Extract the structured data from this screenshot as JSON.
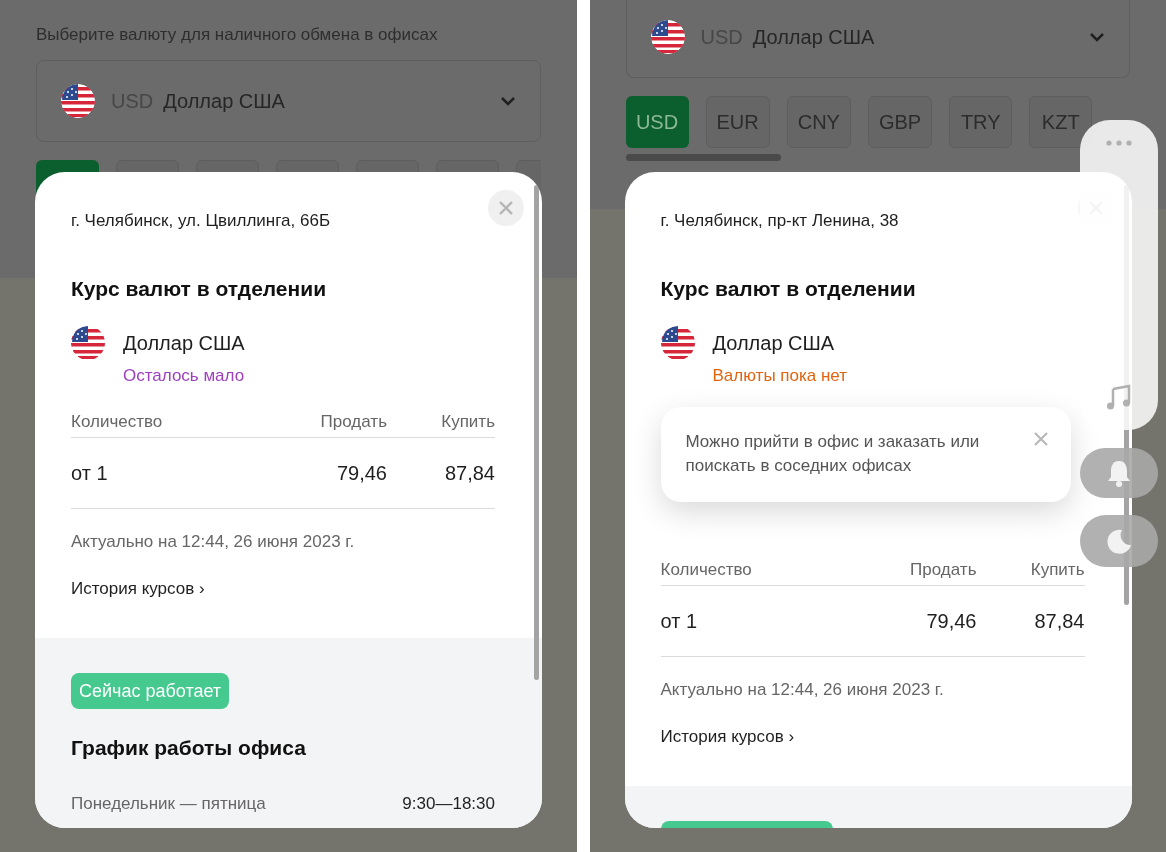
{
  "panels": [
    {
      "prompt": "Выберите валюту для наличного обмена в офисах",
      "currency_select": {
        "code": "USD",
        "name": "Доллар США"
      },
      "chips": [
        {
          "selected": true
        },
        {
          "selected": false
        },
        {
          "selected": false
        },
        {
          "selected": false
        },
        {
          "selected": false
        },
        {
          "selected": false
        },
        {
          "selected": false
        }
      ],
      "modal": {
        "address": "г. Челябинск, ул. Цвиллинга, 66Б",
        "title": "Курс валют в отделении",
        "currency_name": "Доллар США",
        "availability": {
          "kind": "low",
          "text": "Осталось мало"
        },
        "table": {
          "columns": [
            "Количество",
            "Продать",
            "Купить"
          ],
          "rows": [
            [
              "от 1",
              "79,46",
              "87,84"
            ]
          ]
        },
        "updated": "Актуально на 12:44, 26 июня 2023 г.",
        "history_link": "История курсов ›",
        "hours": {
          "badge": "Сейчас работает",
          "title": "График работы офиса",
          "rows": [
            {
              "days": "Понедельник — пятница",
              "time": "9:30—18:30"
            }
          ]
        }
      }
    },
    {
      "currency_select": {
        "code": "USD",
        "name": "Доллар США"
      },
      "chips": [
        {
          "label": "USD",
          "selected": true
        },
        {
          "label": "EUR",
          "selected": false
        },
        {
          "label": "CNY",
          "selected": false
        },
        {
          "label": "GBP",
          "selected": false
        },
        {
          "label": "TRY",
          "selected": false
        },
        {
          "label": "KZT",
          "selected": false
        }
      ],
      "side_toolbar": true,
      "modal": {
        "address": "г. Челябинск, пр-кт Ленина, 38",
        "title": "Курс валют в отделении",
        "currency_name": "Доллар США",
        "availability": {
          "kind": "none",
          "text": "Валюты пока нет"
        },
        "hint": "Можно прийти в офис и заказать или поискать в соседних офисах",
        "table": {
          "columns": [
            "Количество",
            "Продать",
            "Купить"
          ],
          "rows": [
            [
              "от 1",
              "79,46",
              "87,84"
            ]
          ]
        },
        "updated": "Актуально на 12:44, 26 июня 2023 г.",
        "history_link": "История курсов ›",
        "hours": {
          "badge_partial": true
        }
      }
    }
  ]
}
